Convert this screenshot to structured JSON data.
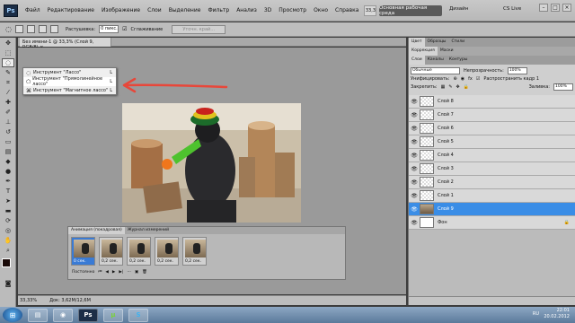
{
  "menubar": {
    "logo": "Ps",
    "items": [
      "Файл",
      "Редактирование",
      "Изображение",
      "Слои",
      "Выделение",
      "Фильтр",
      "Анализ",
      "3D",
      "Просмотр",
      "Окно",
      "Справка"
    ],
    "zoom": "33,3",
    "workspace": "Основная рабочая среда",
    "design": "Дизайн",
    "cslive": "CS Live"
  },
  "options": {
    "feather_label": "Растушевка:",
    "feather_value": "0 пикс.",
    "antialias_label": "Сглаживание",
    "refine_edge": "Уточн. край..."
  },
  "document": {
    "tab_title": "Без имени-1 @ 33,3% (Слой 9, RGB/8)"
  },
  "tool_flyout": {
    "items": [
      {
        "label": "Инструмент \"Лассо\"",
        "key": "L",
        "icon": "lasso-icon"
      },
      {
        "label": "Инструмент \"Прямолинейное лассо\"",
        "key": "L",
        "icon": "polygonal-lasso-icon"
      },
      {
        "label": "Инструмент \"Магнитное лассо\"",
        "key": "L",
        "icon": "magnetic-lasso-icon"
      }
    ]
  },
  "animation_panel": {
    "tabs": [
      "Анимация (покадровая)",
      "Журнал измерений"
    ],
    "frames": [
      {
        "num": "1",
        "delay": "0 сек."
      },
      {
        "num": "2",
        "delay": "0,2 сек."
      },
      {
        "num": "3",
        "delay": "0,2 сек."
      },
      {
        "num": "4",
        "delay": "0,2 сек."
      },
      {
        "num": "5",
        "delay": "0,2 сек."
      }
    ],
    "loop": "Постоянно"
  },
  "status": {
    "zoom": "33,33%",
    "doc": "Док: 3,62M/12,6M"
  },
  "panels": {
    "top_tabs": [
      "Цвет",
      "Образцы",
      "Стили"
    ],
    "mid_tabs": [
      "Коррекция",
      "Маски"
    ],
    "layer_tabs": [
      "Слои",
      "Каналы",
      "Контуры"
    ],
    "blend_mode": "Обычные",
    "opacity_label": "Непрозрачность:",
    "opacity_value": "100%",
    "unify_label": "Унифицировать:",
    "propagate_label": "Распространить кадр 1",
    "lock_label": "Закрепить:",
    "fill_label": "Заливка:",
    "fill_value": "100%",
    "layers": [
      {
        "name": "Слой 8",
        "thumb": "checker"
      },
      {
        "name": "Слой 7",
        "thumb": "checker"
      },
      {
        "name": "Слой 6",
        "thumb": "checker"
      },
      {
        "name": "Слой 5",
        "thumb": "checker"
      },
      {
        "name": "Слой 4",
        "thumb": "checker"
      },
      {
        "name": "Слой 3",
        "thumb": "checker"
      },
      {
        "name": "Слой 2",
        "thumb": "checker"
      },
      {
        "name": "Слой 1",
        "thumb": "checker"
      },
      {
        "name": "Слой 9",
        "thumb": "photo"
      },
      {
        "name": "Фон",
        "thumb": "white"
      }
    ],
    "selected_layer": "Слой 9"
  },
  "taskbar": {
    "apps": [
      "Проводник",
      "Chrome",
      "Photoshop",
      "uTorrent",
      "Skype"
    ],
    "lang": "RU",
    "time": "22:01",
    "date": "20.02.2012"
  },
  "colors": {
    "accent": "#3a8de6",
    "annotation_arrow": "#e8473a"
  }
}
